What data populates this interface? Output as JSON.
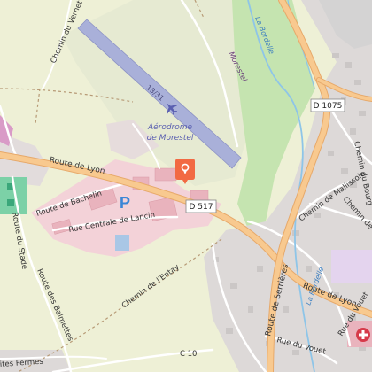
{
  "map": {
    "labels": {
      "route_de_lyon": "Route de Lyon",
      "route_de_lyon_east": "Route de Lyon",
      "route_du_stade": "Route du Stade",
      "route_de_bachelin": "Route de Bachelin",
      "rue_centrale": "Rue Centrale de Lancin",
      "route_des_balmettes": "Route des Balmettes",
      "chemin_entay": "Chemin de l'Entay",
      "chemin_vernet": "Chemin du Vernet",
      "route_de_serrieres": "Route de Serrières",
      "chemin_mallissole": "Chemin de Mallissole",
      "chemin_verne": "Chemin de Ve",
      "chemin_bourg": "Chemin du Bourg",
      "rue_du_vouet": "Rue du Vouet",
      "rue_du_vouet_2": "Rue du Vouet",
      "la_bordelle": "La Bordelle",
      "la_bordelle_2": "La Bordelle",
      "morestel_slope": "Morestel",
      "fermes": "ites Fermes",
      "c10": "C 10",
      "runway_number": "13/31",
      "aerodrome_line1": "Aérodrome",
      "aerodrome_line2": "de Morestel"
    },
    "shields": {
      "d1075": "D 1075",
      "d517": "D 517"
    },
    "icons": {
      "parking": "P",
      "poi_pin": "location-pin-icon",
      "airplane": "airplane-icon",
      "hospital": "hospital-icon"
    },
    "colors": {
      "background": "#eef0d6",
      "forest": "#c9e6b6",
      "urban": "#ddd8d6",
      "commercial": "#f2d4d9",
      "runway": "#a8b0d8",
      "main_road": "#f6c58a",
      "water": "#8ec5e8",
      "poi_pin": "#f26a43"
    }
  }
}
